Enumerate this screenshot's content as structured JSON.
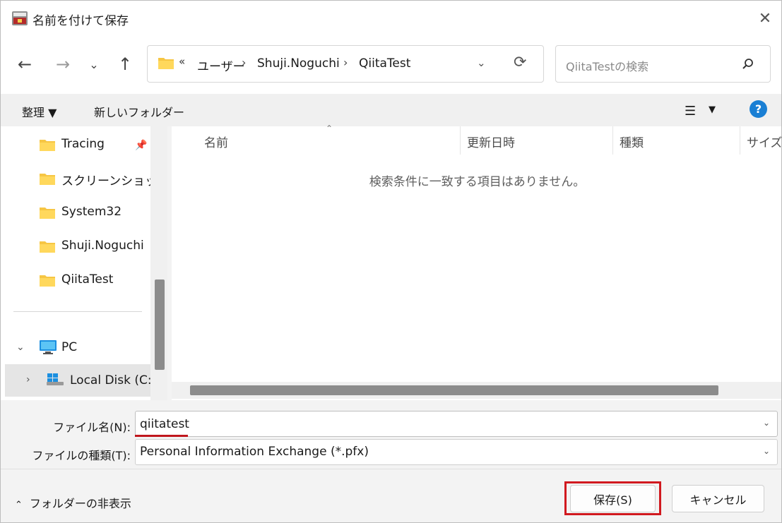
{
  "window": {
    "title": "名前を付けて保存"
  },
  "nav": {
    "back_icon": "arrow-left-icon",
    "forward_icon": "arrow-right-icon",
    "recent_icon": "chevron-down-icon",
    "up_icon": "arrow-up-icon"
  },
  "address": {
    "overflow": "«",
    "crumbs": [
      "ユーザー",
      "Shuji.Noguchi",
      "QiitaTest"
    ],
    "separator": "›"
  },
  "search": {
    "placeholder": "QiitaTestの検索"
  },
  "commandbar": {
    "organize": "整理 ▼",
    "new_folder": "新しいフォルダー"
  },
  "navpane": {
    "quick_access": [
      {
        "label": "Tracing",
        "pinned": true
      },
      {
        "label": "スクリーンショット"
      },
      {
        "label": "System32"
      },
      {
        "label": "Shuji.Noguchi"
      },
      {
        "label": "QiitaTest"
      }
    ],
    "pc": {
      "label": "PC"
    },
    "local_disk": {
      "label": "Local Disk (C:)"
    }
  },
  "filelist": {
    "columns": [
      "名前",
      "更新日時",
      "種類",
      "サイズ"
    ],
    "empty_message": "検索条件に一致する項目はありません。"
  },
  "form": {
    "filename_label": "ファイル名(N):",
    "filename_value": "qiitatest",
    "filetype_label": "ファイルの種類(T):",
    "filetype_value": "Personal Information Exchange (*.pfx)"
  },
  "footer": {
    "hide_folders": "フォルダーの非表示",
    "save": "保存(S)",
    "cancel": "キャンセル"
  },
  "colors": {
    "accent": "#1a7fd4",
    "highlight": "#d1191f",
    "folder": "#f6c644"
  }
}
